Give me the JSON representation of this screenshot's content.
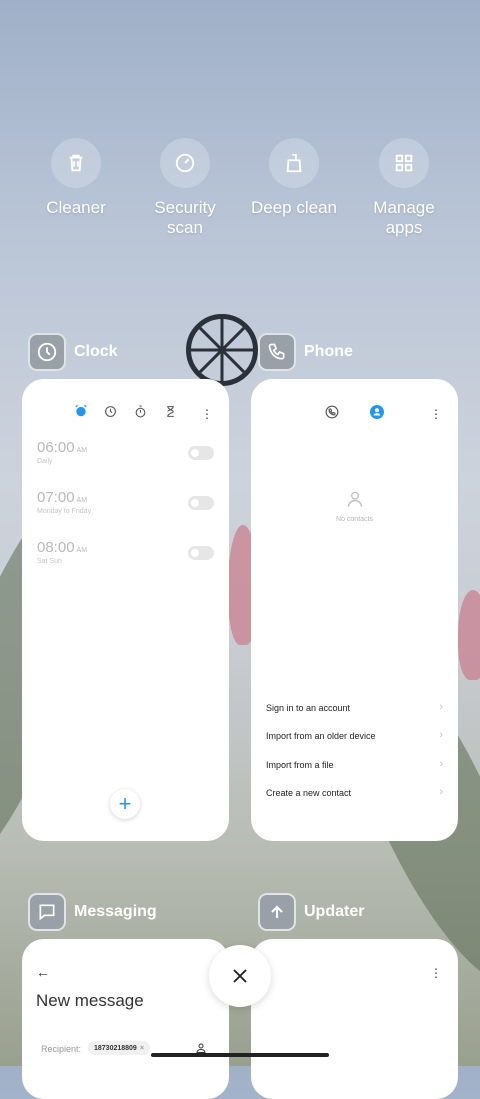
{
  "quick_actions": [
    {
      "label_line1": "Cleaner",
      "label_line2": "",
      "icon": "trash-icon"
    },
    {
      "label_line1": "Security",
      "label_line2": "scan",
      "icon": "gauge-icon"
    },
    {
      "label_line1": "Deep clean",
      "label_line2": "",
      "icon": "broom-icon"
    },
    {
      "label_line1": "Manage",
      "label_line2": "apps",
      "icon": "grid-icon"
    }
  ],
  "apps": {
    "clock": {
      "name": "Clock",
      "alarms": [
        {
          "time": "06:00",
          "ampm": "AM",
          "repeat": "Daily"
        },
        {
          "time": "07:00",
          "ampm": "AM",
          "repeat": "Monday to Friday"
        },
        {
          "time": "08:00",
          "ampm": "AM",
          "repeat": "Sat Sun"
        }
      ],
      "fab": "+"
    },
    "phone": {
      "name": "Phone",
      "empty_text": "No contacts",
      "options": [
        "Sign in to an account",
        "Import from an older device",
        "Import from a file",
        "Create a new contact"
      ]
    },
    "messaging": {
      "name": "Messaging",
      "title": "New message",
      "recipient_label": "Recipient:",
      "recipient_value": "18730218809",
      "chip_close": "×"
    },
    "updater": {
      "name": "Updater"
    }
  },
  "colors": {
    "accent": "#2196f3"
  }
}
